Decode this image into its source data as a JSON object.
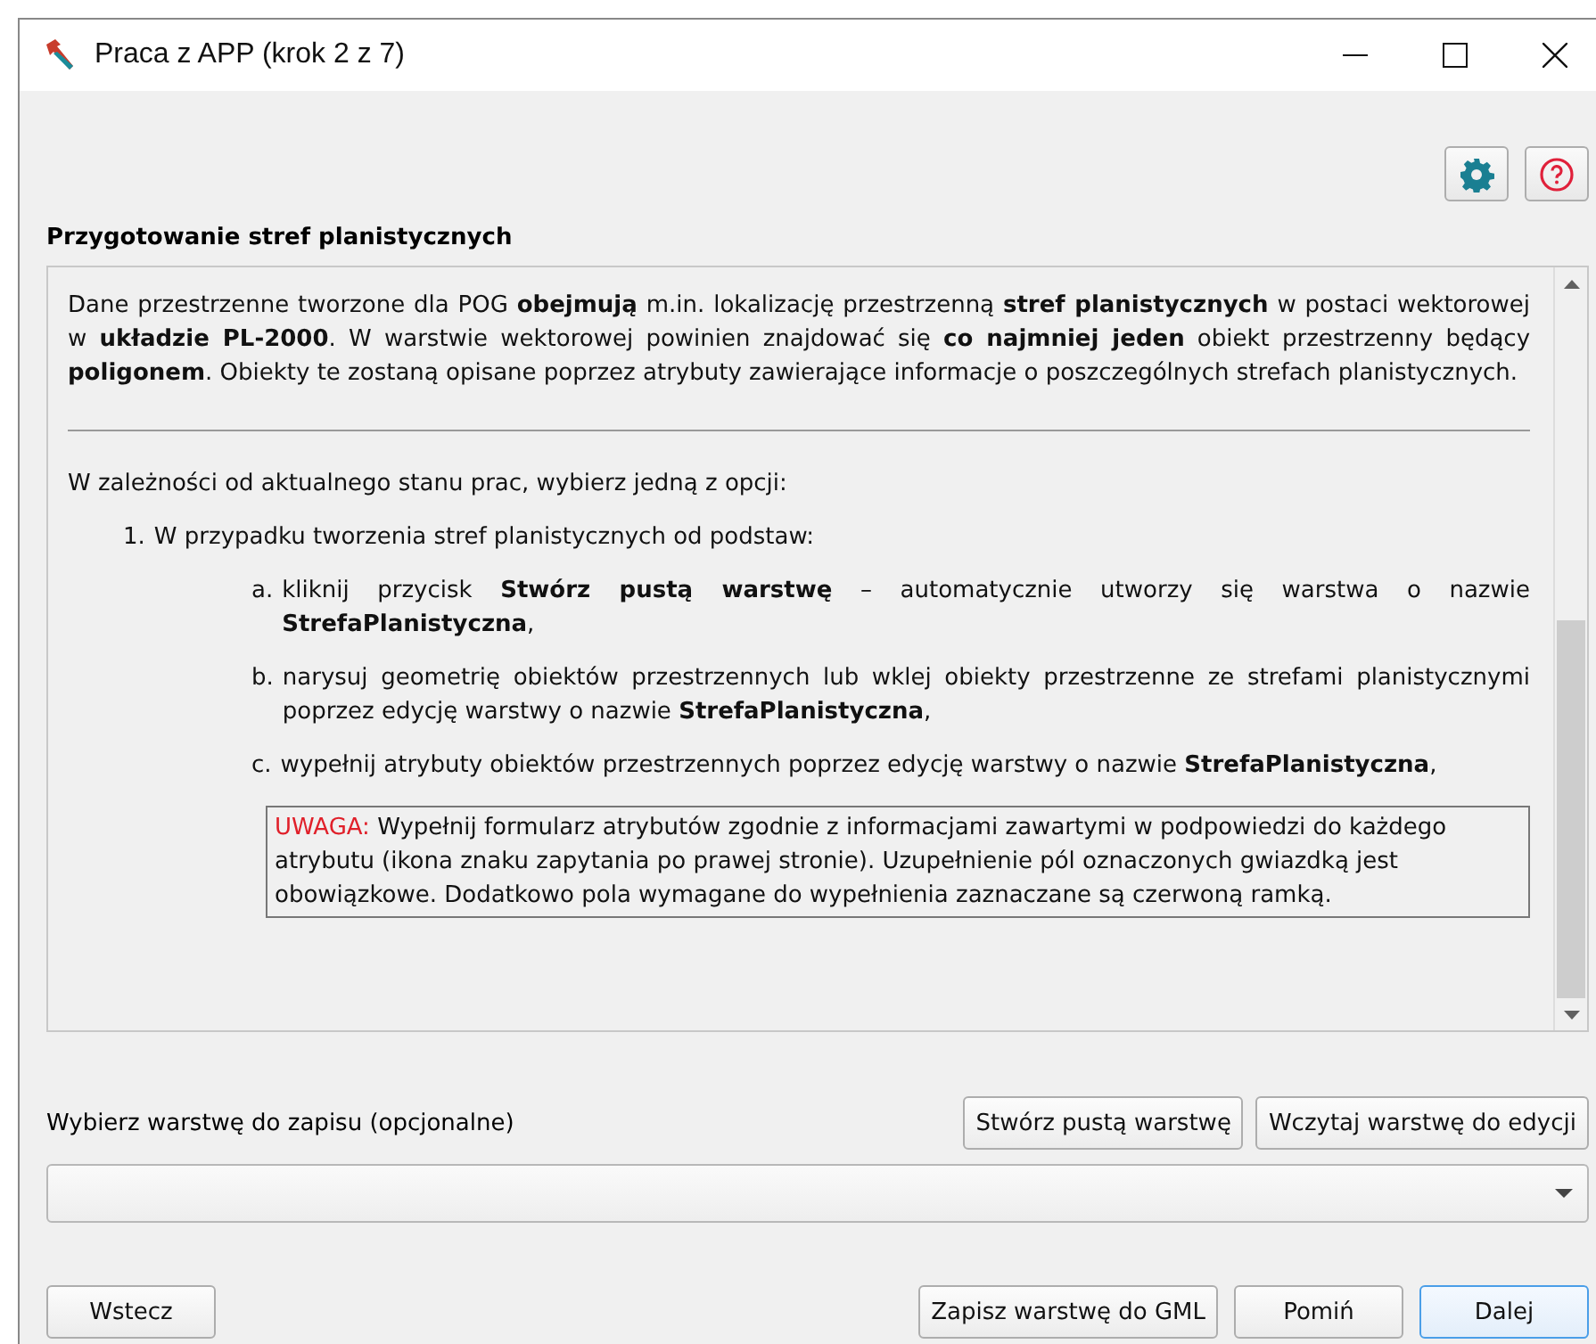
{
  "window": {
    "title": "Praca z APP (krok 2 z 7)"
  },
  "toolbar": {
    "buttons": [
      {
        "kind": "settings"
      },
      {
        "kind": "help"
      }
    ]
  },
  "section_title": "Przygotowanie stref planistycznych",
  "content": {
    "intro": "Dane przestrzenne tworzone dla POG **obejmują** m.in. lokalizację przestrzenną **stref planistycznych** w postaci wektorowej w **układzie PL-2000**. W warstwie wektorowej powinien znajdować się **co najmniej jeden** obiekt przestrzenny będący **poligonem**. Obiekty te zostaną opisane poprzez atrybuty zawierające informacje o poszczególnych strefach planistycznych.",
    "lead": "W zależności od aktualnego stanu prac, wybierz jedną z opcji:",
    "options": [
      {
        "marker": "1.",
        "text": "W przypadku tworzenia stref planistycznych od podstaw:",
        "steps": [
          {
            "marker": "a.",
            "text": "kliknij przycisk **Stwórz pustą warstwę** – automatycznie utworzy się warstwa o nazwie **StrefaPlanistyczna**,"
          },
          {
            "marker": "b.",
            "text": "narysuj geometrię obiektów przestrzennych lub wklej obiekty przestrzenne ze strefami planistycznymi poprzez edycję warstwy o nazwie **StrefaPlanistyczna**,"
          },
          {
            "marker": "c.",
            "text": "wypełnij atrybuty obiektów przestrzennych poprzez edycję warstwy o nazwie **StrefaPlanistyczna**,"
          }
        ]
      }
    ],
    "note": {
      "label": "UWAGA:",
      "text": "Wypełnij formularz atrybutów zgodnie z informacjami zawartymi w podpowiedzi do każdego atrybutu (ikona znaku zapytania po prawej stronie). Uzupełnienie pól oznaczonych gwiazdką jest obowiązkowe. Dodatkowo pola wymagane do wypełnienia zaznaczane są czerwoną ramką."
    }
  },
  "layer": {
    "label": "Wybierz warstwę do zapisu (opcjonalne)",
    "buttons": [
      "Stwórz pustą warstwę",
      "Wczytaj warstwę do edycji"
    ]
  },
  "footer": {
    "back": "Wstecz",
    "buttons": [
      {
        "label": "Zapisz warstwę do GML",
        "default": false
      },
      {
        "label": "Pomiń",
        "default": false
      },
      {
        "label": "Dalej",
        "default": true
      }
    ]
  }
}
